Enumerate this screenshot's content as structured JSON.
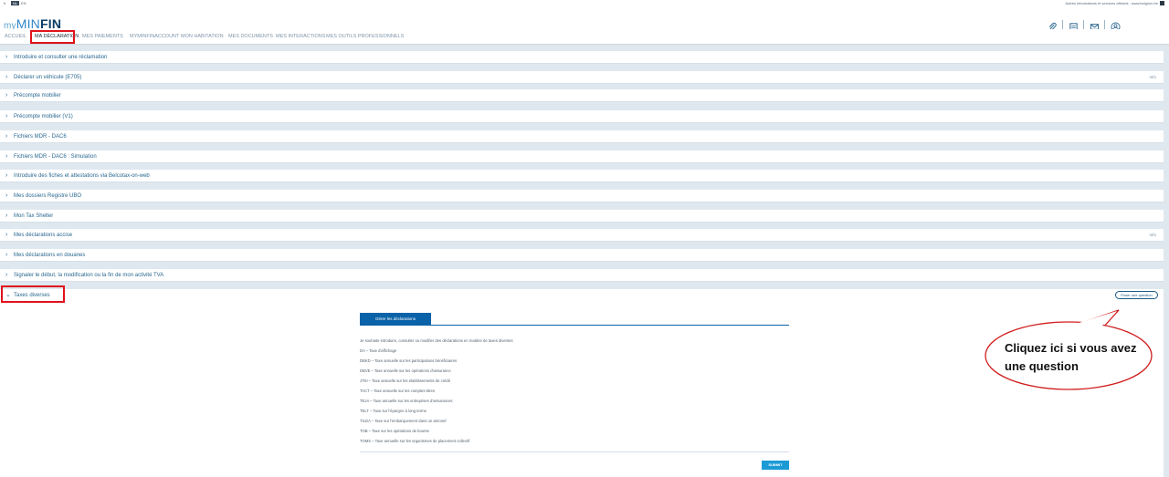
{
  "topbar": {
    "languages": [
      "fr",
      "NL",
      "EN"
    ],
    "active_language": "NL",
    "gov_link": "Autres informations et services officiels : www.belgium.be"
  },
  "header": {
    "logo_prefix": "my",
    "logo_min": "MIN",
    "logo_fin": "FIN",
    "icons": [
      "paperclip-icon",
      "document-icon",
      "mail-icon",
      "user-icon"
    ]
  },
  "nav": {
    "items": [
      "ACCUEIL",
      "MA DÉCLARATION",
      "MES PAIEMENTS",
      "MYMINFINACCOUNT",
      "MON HABITATION",
      "MES DOCUMENTS",
      "MES INTERACTIONS",
      "MES OUTILS PROFESSIONNELS"
    ],
    "active": "MA DÉCLARATION"
  },
  "rows": [
    {
      "label": "Introduire et consulter une réclamation",
      "info": ""
    },
    {
      "label": "Déclarer un véhicule (E705)",
      "info": "Info"
    },
    {
      "label": "Précompte mobilier",
      "info": ""
    },
    {
      "label": "Précompte mobilier (V1)",
      "info": ""
    },
    {
      "label": "Fichiers MDR - DAC6",
      "info": ""
    },
    {
      "label": "Fichiers MDR - DAC6 : Simulation",
      "info": ""
    },
    {
      "label": "Introduire des fiches et attestations via Belcotax-on-web",
      "info": ""
    },
    {
      "label": "Mes dossiers Registre UBO",
      "info": ""
    },
    {
      "label": "Mon Tax Shelter",
      "info": ""
    },
    {
      "label": "Mes déclarations accise",
      "info": "Info"
    },
    {
      "label": "Mes déclarations en douanes",
      "info": ""
    },
    {
      "label": "Signaler le début, la modification ou la fin de mon activité TVA",
      "info": ""
    }
  ],
  "expanded": {
    "label": "Taxes diverses",
    "question_button": "Poser une question",
    "tab_label": "Gérer les déclarations",
    "intro": "Je souhaite introduire, consulter ou modifier des déclarations en matière de taxes diverses",
    "items": [
      "DA – Taxe d'affichage",
      "DBKD – Taxe annuelle sur les participations bénéficiaires",
      "DBVE – Taxe annuelle sur les opérations d'assurance",
      "JTKI – Taxe annuelle sur les établissements de crédit",
      "TACT – Taxe annuelle sur les comptes-titres",
      "TEJA – Taxe annuelle sur les entreprises d'assurances",
      "TELT – Taxe sur l'épargne à long terme",
      "TILDA – Taxe sur l'embarquement dans un aéronef",
      "TOB – Taxe sur les opérations de bourse",
      "TOMS – Taxe annuelle sur les organismes de placement collectif"
    ],
    "submit_label": "SUBMIT"
  },
  "callout": {
    "text": "Cliquez ici si vous avez une question"
  },
  "colors": {
    "brand_blue": "#0a62a8",
    "highlight_red": "#e0121b",
    "submit_blue": "#1b9ad6"
  }
}
